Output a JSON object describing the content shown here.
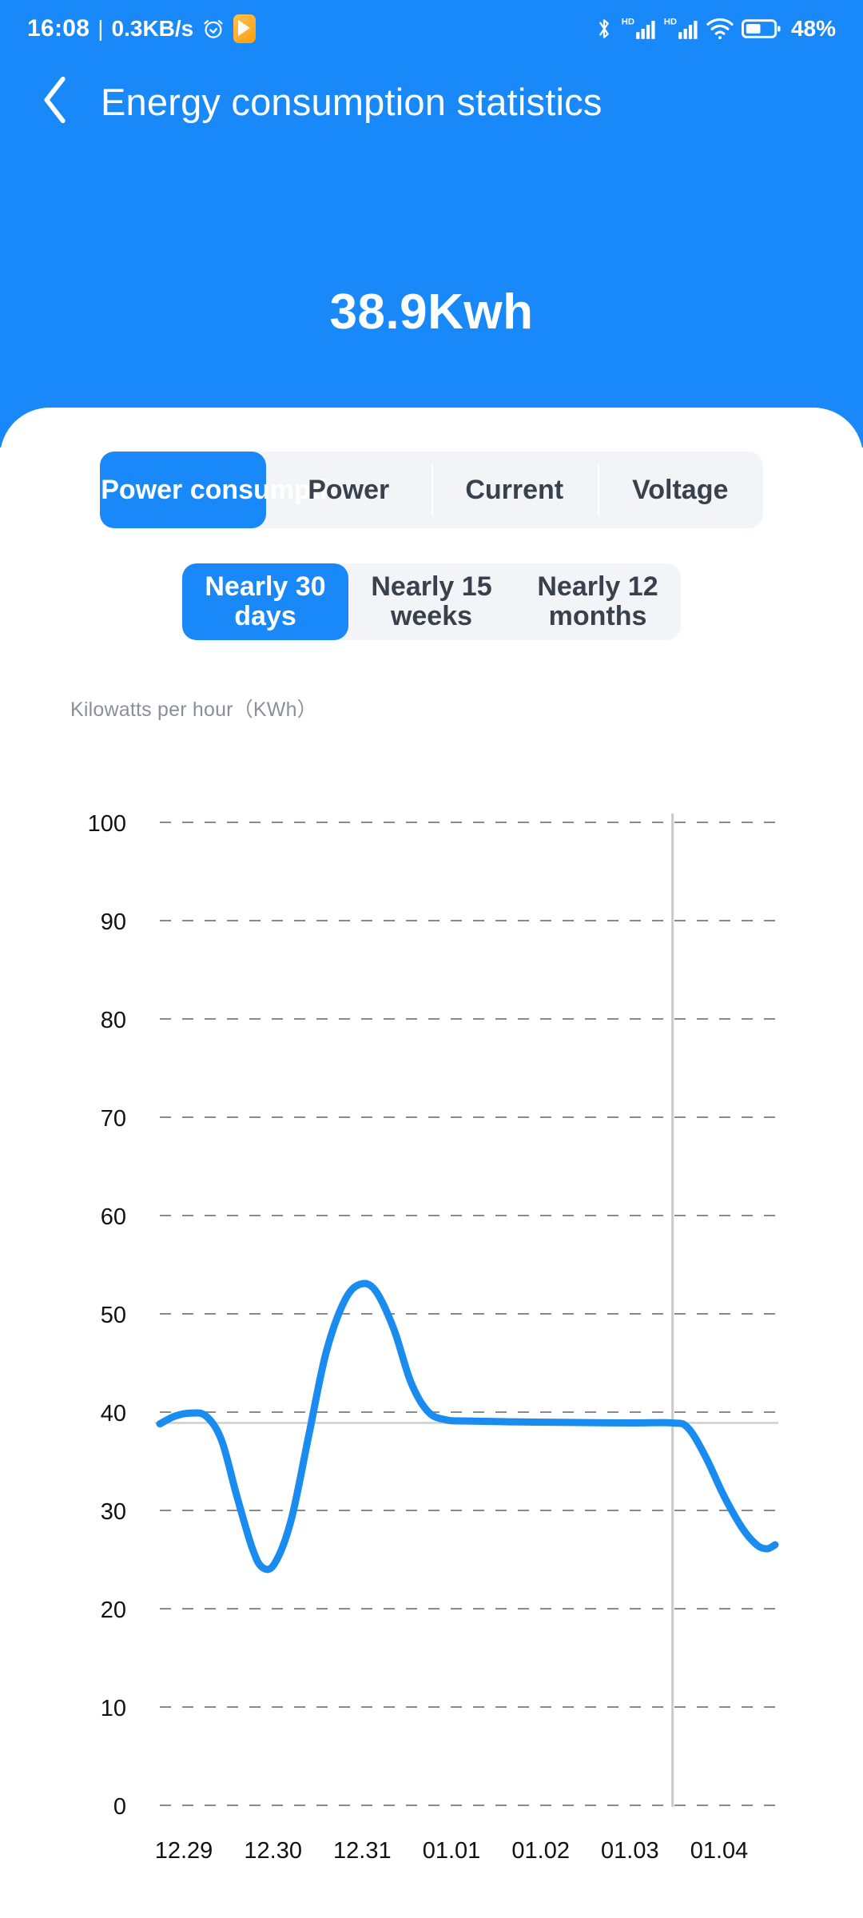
{
  "statusbar": {
    "time": "16:08",
    "separator": "|",
    "network_speed": "0.3KB/s",
    "alarm_icon": "alarm-clock-icon",
    "app_icon": "orange-app-icon",
    "bluetooth_icon": "bluetooth-icon",
    "signal_icon_1": "hd-signal-icon",
    "signal_icon_2": "hd-signal-icon",
    "signal_badge": "HD",
    "wifi_icon": "wifi-icon",
    "battery_icon": "battery-icon",
    "battery_percent": "48%"
  },
  "header": {
    "back_icon": "chevron-left-icon",
    "title": "Energy consumption statistics"
  },
  "summary": {
    "total_value": "38.9Kwh"
  },
  "metric_tabs": {
    "selected_index": 0,
    "items": [
      {
        "label": "Power consumptio"
      },
      {
        "label": "Power"
      },
      {
        "label": "Current"
      },
      {
        "label": "Voltage"
      }
    ]
  },
  "range_tabs": {
    "selected_index": 0,
    "items": [
      {
        "label": "Nearly 30 days"
      },
      {
        "label": "Nearly 15 weeks"
      },
      {
        "label": "Nearly 12 months"
      }
    ]
  },
  "chart_caption": "Kilowatts per hour（KWh）",
  "colors": {
    "brand_blue": "#1989fa",
    "line_blue": "#1a8cf0",
    "tab_track": "#f2f4f7",
    "grid": "#8a8a8a",
    "reference_line": "#cfcfcf",
    "marker_line": "#c9c9c9",
    "text_dark": "#39414d"
  },
  "chart_data": {
    "type": "line",
    "title": "",
    "xlabel": "",
    "ylabel": "Kilowatts per hour（KWh）",
    "ylim": [
      0,
      100
    ],
    "yticks": [
      100,
      90,
      80,
      70,
      60,
      50,
      40,
      30,
      20,
      10,
      0
    ],
    "grid": true,
    "legend": "none",
    "categories": [
      "12.29",
      "12.30",
      "12.31",
      "01.01",
      "01.02",
      "01.03",
      "01.04"
    ],
    "x": [
      0,
      1,
      2,
      3,
      4,
      5,
      6
    ],
    "series": [
      {
        "name": "Power consumption",
        "color": "#1a8cf0",
        "values": [
          38.8,
          24.2,
          53.0,
          39.2,
          38.9,
          38.9,
          26.5
        ]
      }
    ],
    "dense_points": [
      {
        "x": 0.0,
        "y": 38.8
      },
      {
        "x": 0.15,
        "y": 39.6
      },
      {
        "x": 0.3,
        "y": 39.9
      },
      {
        "x": 0.45,
        "y": 39.6
      },
      {
        "x": 0.6,
        "y": 37.2
      },
      {
        "x": 0.75,
        "y": 31.5
      },
      {
        "x": 0.9,
        "y": 26.2
      },
      {
        "x": 1.0,
        "y": 24.2
      },
      {
        "x": 1.12,
        "y": 24.6
      },
      {
        "x": 1.28,
        "y": 29.0
      },
      {
        "x": 1.45,
        "y": 37.5
      },
      {
        "x": 1.62,
        "y": 46.0
      },
      {
        "x": 1.8,
        "y": 51.3
      },
      {
        "x": 1.95,
        "y": 53.0
      },
      {
        "x": 2.1,
        "y": 52.4
      },
      {
        "x": 2.28,
        "y": 48.5
      },
      {
        "x": 2.45,
        "y": 43.0
      },
      {
        "x": 2.62,
        "y": 40.0
      },
      {
        "x": 2.8,
        "y": 39.2
      },
      {
        "x": 3.0,
        "y": 39.1
      },
      {
        "x": 3.5,
        "y": 39.0
      },
      {
        "x": 4.0,
        "y": 38.95
      },
      {
        "x": 4.6,
        "y": 38.9
      },
      {
        "x": 5.0,
        "y": 38.9
      },
      {
        "x": 5.15,
        "y": 38.4
      },
      {
        "x": 5.32,
        "y": 35.5
      },
      {
        "x": 5.5,
        "y": 31.5
      },
      {
        "x": 5.68,
        "y": 28.2
      },
      {
        "x": 5.82,
        "y": 26.5
      },
      {
        "x": 5.92,
        "y": 26.1
      },
      {
        "x": 6.0,
        "y": 26.5
      }
    ],
    "reference_line": {
      "value": 38.9,
      "color": "#cfcfcf"
    },
    "marker_line": {
      "category": "01.03",
      "x": 5,
      "color": "#c9c9c9"
    }
  }
}
